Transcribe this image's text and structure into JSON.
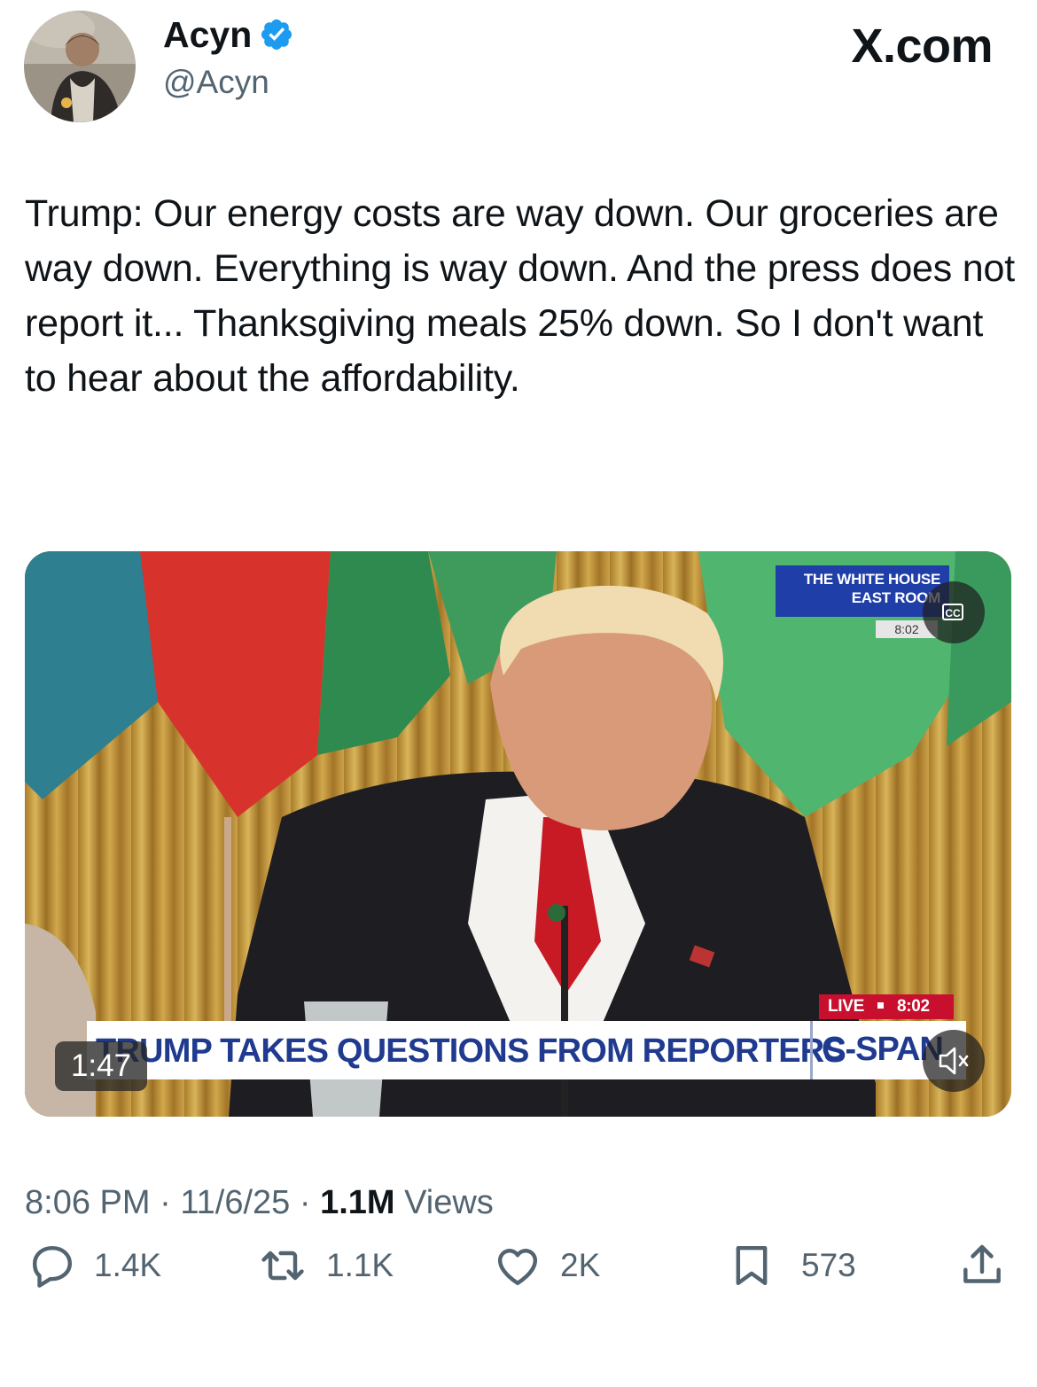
{
  "header": {
    "display_name": "Acyn",
    "handle": "@Acyn",
    "brand": "X.com",
    "verified": true
  },
  "tweet": {
    "text": "Trump: Our energy costs are way down. Our groceries are way down. Everything is way down. And the press does not report it... Thanksgiving meals 25% down. So I don't want to hear about the affordability."
  },
  "video": {
    "duration": "1:47",
    "overlay": {
      "location_line1": "THE WHITE HOUSE",
      "location_line2": "EAST ROOM",
      "location_time": "8:02",
      "live_label": "LIVE",
      "live_time": "8:02",
      "headline": "TRUMP TAKES QUESTIONS FROM REPORTERS",
      "network": "C-SPAN"
    },
    "cc_icon": "closed-captions-icon",
    "mute_icon": "speaker-muted-icon"
  },
  "meta": {
    "time": "8:06 PM",
    "date": "11/6/25",
    "views_count": "1.1M",
    "views_label": "Views",
    "separator": "·"
  },
  "actions": {
    "replies": "1.4K",
    "reposts": "1.1K",
    "likes": "2K",
    "bookmarks": "573"
  },
  "colors": {
    "text": "#0f1419",
    "secondary": "#536471",
    "verified": "#1d9bf0",
    "cspan_blue": "#1f3a8f",
    "live_red": "#c8102e"
  }
}
